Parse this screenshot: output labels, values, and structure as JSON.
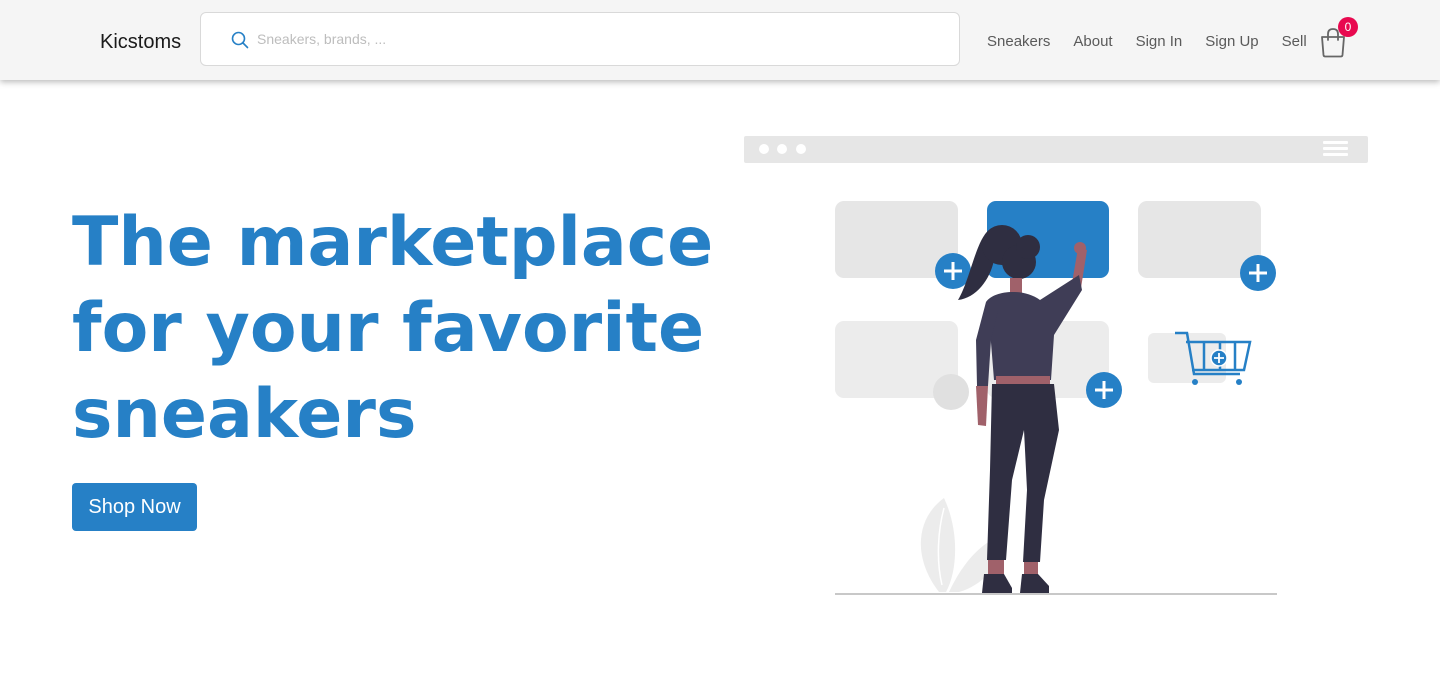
{
  "header": {
    "logo": "Kicstoms",
    "search": {
      "placeholder": "Sneakers, brands, ...",
      "value": ""
    },
    "nav": [
      {
        "label": "Sneakers"
      },
      {
        "label": "About"
      },
      {
        "label": "Sign In"
      },
      {
        "label": "Sign Up"
      },
      {
        "label": "Sell"
      }
    ],
    "cart": {
      "count": "0",
      "icon": "shopping-bag-icon"
    }
  },
  "hero": {
    "title_lines": [
      "The marketplace",
      "for your favorite",
      "sneakers"
    ],
    "cta_label": "Shop Now"
  },
  "colors": {
    "accent": "#2680c6",
    "badge": "#e8094f",
    "header_bg": "#f5f5f5",
    "placeholder_card": "#e6e6e6",
    "figure_dark": "#2f2e41"
  }
}
